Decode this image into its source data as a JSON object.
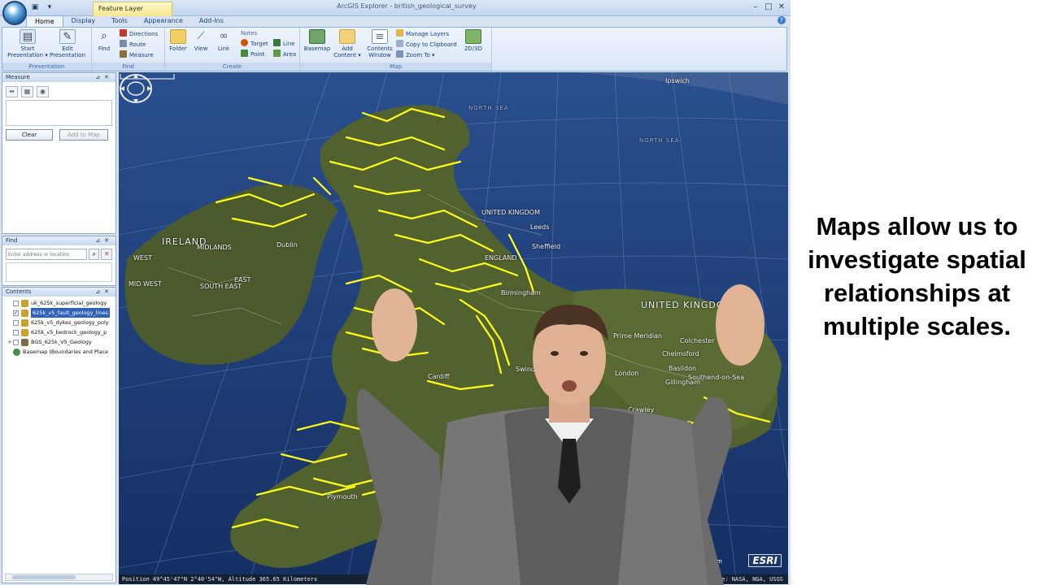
{
  "window": {
    "title": "ArcGIS Explorer - british_geological_survey",
    "context_tab": "Feature Layer",
    "controls": [
      "–",
      "□",
      "✕"
    ]
  },
  "ribbon": {
    "tabs": [
      "Home",
      "Display",
      "Tools",
      "Appearance",
      "Add-Ins"
    ],
    "active_tab": "Home",
    "groups": {
      "presentation": {
        "label": "Presentation",
        "start": "Start Presentation ▾",
        "edit": "Edit Presentation"
      },
      "find": {
        "label": "Find",
        "find": "Find",
        "directions": "Directions",
        "route": "Route",
        "measure": "Measure"
      },
      "create": {
        "label": "Create",
        "folder": "Folder",
        "view": "View",
        "link": "Link",
        "notes": "Notes",
        "target": "Target",
        "line": "Line",
        "point": "Point",
        "area": "Area"
      },
      "map": {
        "label": "Map",
        "basemap": "Basemap",
        "add_content": "Add Content ▾",
        "contents_window": "Contents Window",
        "manage_layers": "Manage Layers",
        "copy_clipboard": "Copy to Clipboard",
        "zoom_to": "Zoom To ▾",
        "view_mode": "2D/3D"
      }
    }
  },
  "measure_panel": {
    "title": "Measure",
    "clear": "Clear",
    "add_to_map": "Add to Map"
  },
  "find_panel": {
    "title": "Find",
    "placeholder": "Enter address or location"
  },
  "contents_panel": {
    "title": "Contents",
    "layers": [
      {
        "name": "uk_625k_superficial_geology",
        "checked": false,
        "expandable": false,
        "selected": false
      },
      {
        "name": "625k_v5_fault_geology_lines",
        "checked": true,
        "expandable": false,
        "selected": true
      },
      {
        "name": "625k_v5_dykes_geology_poly",
        "checked": false,
        "expandable": false,
        "selected": false
      },
      {
        "name": "625k_v5_bedrock_geology_p",
        "checked": false,
        "expandable": false,
        "selected": false
      },
      {
        "name": "BGS_625k_V5_Geology",
        "checked": false,
        "expandable": true,
        "selected": false
      },
      {
        "name": "Basemap (Boundaries and Place",
        "checked": null,
        "expandable": false,
        "selected": false
      }
    ]
  },
  "map": {
    "labels": {
      "ireland": "IRELAND",
      "midlands": "MIDLANDS",
      "dublin": "Dublin",
      "west": "WEST",
      "mid_west": "MID WEST",
      "east": "EAST",
      "south_east": "SOUTH EAST",
      "united_kingdom_small": "UNITED KINGDOM",
      "united_kingdom": "UNITED KINGDOM",
      "england": "ENGLAND",
      "birmingham": "Birmingham",
      "leeds": "Leeds",
      "sheffield": "Sheffield",
      "cardiff": "Cardiff",
      "swindon": "Swindon",
      "london": "London",
      "crawley": "Crawley",
      "plymouth": "Plymouth",
      "prime_meridian": "Prime Meridian",
      "north_sea": "NORTH SEA",
      "north_sea_2": "NORTH SEA",
      "colchester": "Colchester",
      "chelmsford": "Chelmsford",
      "basildon": "Basildon",
      "southend": "Southend-on-Sea",
      "gillingham": "Gillingham",
      "ipswich": "Ipswich"
    },
    "scale": "59km",
    "logo": "ESRI",
    "status_position": "Position 49°45'47\"N 2°40'54\"W, Altitude 365.65 Kilometers",
    "status_source": "Source: NASA, NGA, USGS",
    "colors": {
      "ocean": "#17376e",
      "land": "#4a5a2c",
      "fault_lines": "#ffff1a",
      "grid": "#8aa0c8"
    }
  },
  "caption": "Maps allow us to investigate spatial relationships at multiple scales."
}
